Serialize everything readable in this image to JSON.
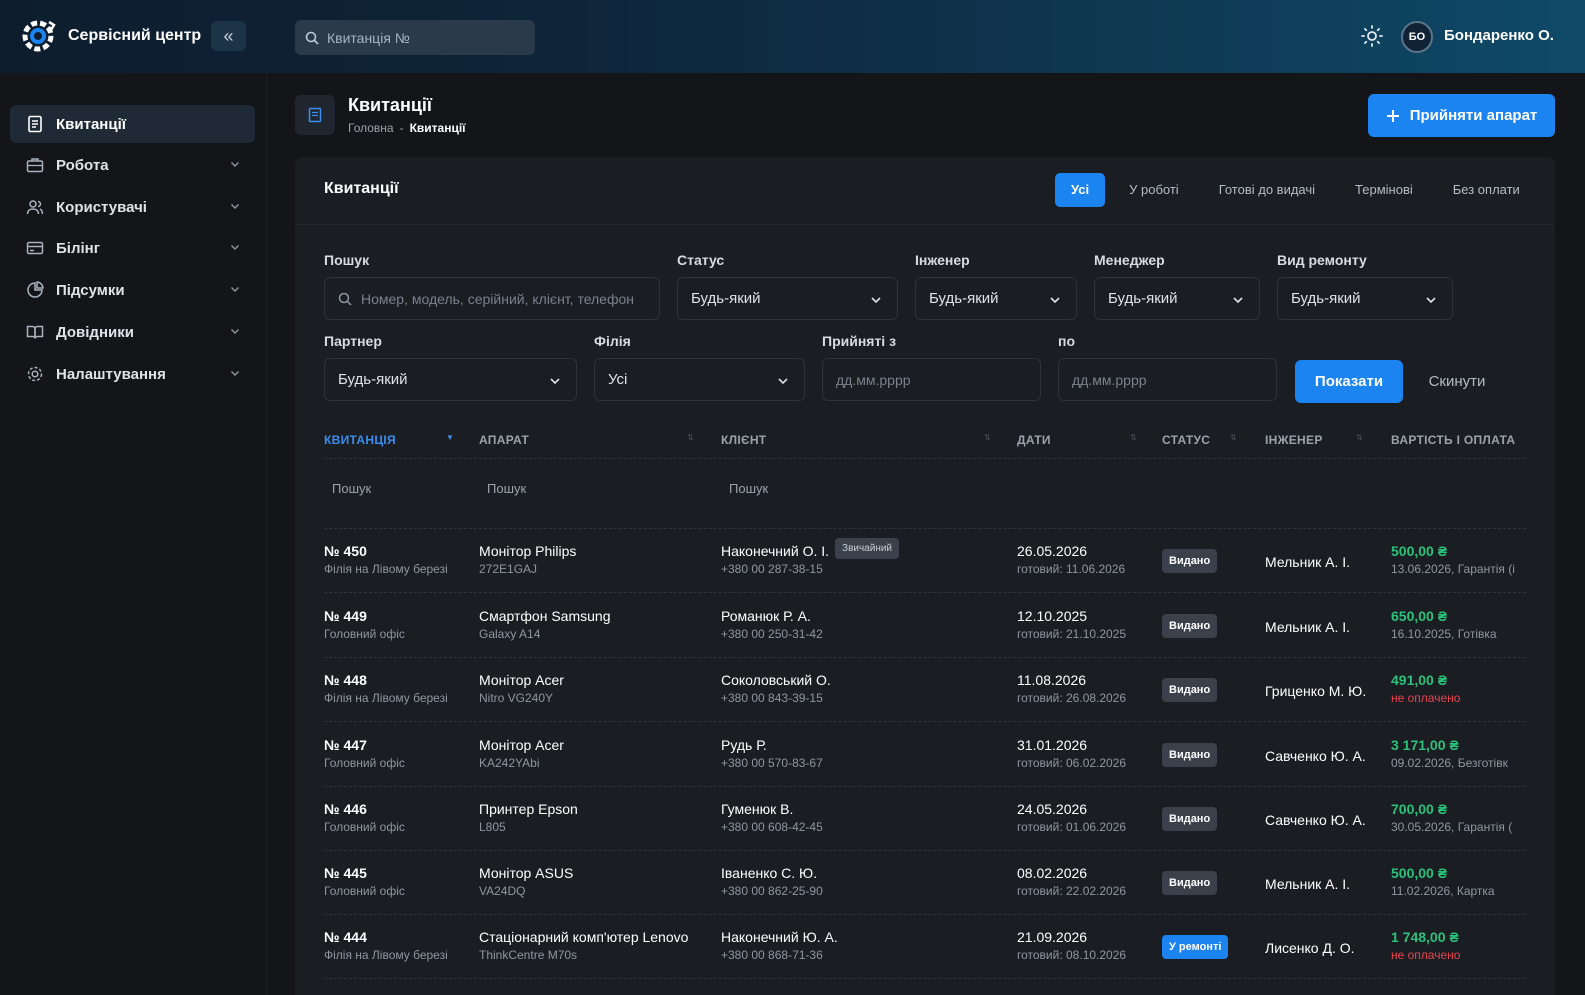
{
  "topbar": {
    "app_title": "Сервісний центр",
    "collapse_label": "«",
    "search_placeholder": "Квитанція №",
    "user_initials": "БО",
    "user_name": "Бондаренко О."
  },
  "sidebar": {
    "items": [
      {
        "label": "Квитанції",
        "icon": "receipt-icon",
        "active": true
      },
      {
        "label": "Робота",
        "icon": "briefcase-icon"
      },
      {
        "label": "Користувачі",
        "icon": "users-icon"
      },
      {
        "label": "Білінг",
        "icon": "credit-card-icon"
      },
      {
        "label": "Підсумки",
        "icon": "pie-chart-icon"
      },
      {
        "label": "Довідники",
        "icon": "book-icon"
      },
      {
        "label": "Налаштування",
        "icon": "gear-icon"
      }
    ]
  },
  "page": {
    "title": "Квитанції",
    "breadcrumb_home": "Головна",
    "breadcrumb_sep": "-",
    "breadcrumb_current": "Квитанції",
    "primary_button": "Прийняти апарат"
  },
  "card": {
    "title": "Квитанції",
    "tabs": [
      "Усі",
      "У роботі",
      "Готові до видачі",
      "Термінові",
      "Без оплати"
    ]
  },
  "filters": {
    "search_label": "Пошук",
    "search_placeholder": "Номер, модель, серійний, клієнт, телефон",
    "status_label": "Статус",
    "status_value": "Будь-який",
    "engineer_label": "Інженер",
    "engineer_value": "Будь-який",
    "manager_label": "Менеджер",
    "manager_value": "Будь-який",
    "repair_type_label": "Вид ремонту",
    "repair_type_value": "Будь-який",
    "partner_label": "Партнер",
    "partner_value": "Будь-який",
    "branch_label": "Філія",
    "branch_value": "Усі",
    "date_from_label": "Прийняті з",
    "date_from_placeholder": "дд.мм.рррр",
    "date_to_label": "по",
    "date_to_placeholder": "дд.мм.рррр",
    "show_button": "Показати",
    "reset_button": "Скинути"
  },
  "table": {
    "columns": [
      "КВИТАНЦІЯ",
      "АПАРАТ",
      "КЛІЄНТ",
      "ДАТИ",
      "СТАТУС",
      "ІНЖЕНЕР",
      "ВАРТІСТЬ І ОПЛАТА"
    ],
    "filter_placeholder": "Пошук",
    "rows": [
      {
        "number": "№ 450",
        "branch": "Філія на Лівому березі",
        "device": "Монітор Philips",
        "model": "272E1GAJ",
        "client": "Наконечний О. І.",
        "client_tag": "Звичайний",
        "phone": "+380 00 287-38-15",
        "date": "26.05.2026",
        "ready": "готовий: 11.06.2026",
        "status": "Видано",
        "engineer": "Мельник А. І.",
        "price": "500,00 ₴",
        "payment": "13.06.2026, Гарантія (і",
        "unpaid": false
      },
      {
        "number": "№ 449",
        "branch": "Головний офіс",
        "device": "Смартфон Samsung",
        "model": "Galaxy A14",
        "client": "Романюк Р. А.",
        "client_tag": "",
        "phone": "+380 00 250-31-42",
        "date": "12.10.2025",
        "ready": "готовий: 21.10.2025",
        "status": "Видано",
        "engineer": "Мельник А. І.",
        "price": "650,00 ₴",
        "payment": "16.10.2025, Готівка",
        "unpaid": false
      },
      {
        "number": "№ 448",
        "branch": "Філія на Лівому березі",
        "device": "Монітор Acer",
        "model": "Nitro VG240Y",
        "client": "Соколовський О.",
        "client_tag": "",
        "phone": "+380 00 843-39-15",
        "date": "11.08.2026",
        "ready": "готовий: 26.08.2026",
        "status": "Видано",
        "engineer": "Гриценко М. Ю.",
        "price": "491,00 ₴",
        "payment": "не оплачено",
        "unpaid": true
      },
      {
        "number": "№ 447",
        "branch": "Головний офіс",
        "device": "Монітор Acer",
        "model": "KA242YAbi",
        "client": "Рудь Р.",
        "client_tag": "",
        "phone": "+380 00 570-83-67",
        "date": "31.01.2026",
        "ready": "готовий: 06.02.2026",
        "status": "Видано",
        "engineer": "Савченко Ю. А.",
        "price": "3 171,00 ₴",
        "payment": "09.02.2026, Безготівк",
        "unpaid": false
      },
      {
        "number": "№ 446",
        "branch": "Головний офіс",
        "device": "Принтер Epson",
        "model": "L805",
        "client": "Гуменюк В.",
        "client_tag": "",
        "phone": "+380 00 608-42-45",
        "date": "24.05.2026",
        "ready": "готовий: 01.06.2026",
        "status": "Видано",
        "engineer": "Савченко Ю. А.",
        "price": "700,00 ₴",
        "payment": "30.05.2026, Гарантія (",
        "unpaid": false
      },
      {
        "number": "№ 445",
        "branch": "Головний офіс",
        "device": "Монітор ASUS",
        "model": "VA24DQ",
        "client": "Іваненко С. Ю.",
        "client_tag": "",
        "phone": "+380 00 862-25-90",
        "date": "08.02.2026",
        "ready": "готовий: 22.02.2026",
        "status": "Видано",
        "engineer": "Мельник А. І.",
        "price": "500,00 ₴",
        "payment": "11.02.2026, Картка",
        "unpaid": false
      },
      {
        "number": "№ 444",
        "branch": "Філія на Лівому березі",
        "device": "Стаціонарний комп'ютер Lenovo",
        "model": "ThinkCentre M70s",
        "client": "Наконечний Ю. А.",
        "client_tag": "",
        "phone": "+380 00 868-71-36",
        "date": "21.09.2026",
        "ready": "готовий: 08.10.2026",
        "status": "У ремонті",
        "engineer": "Лисенко Д. О.",
        "price": "1 748,00 ₴",
        "payment": "не оплачено",
        "unpaid": true
      }
    ]
  },
  "colors": {
    "accent": "#1b84f0",
    "price": "#2cc27a",
    "unpaid": "#e8434f",
    "background": "#131519",
    "card": "#1a1d22"
  }
}
